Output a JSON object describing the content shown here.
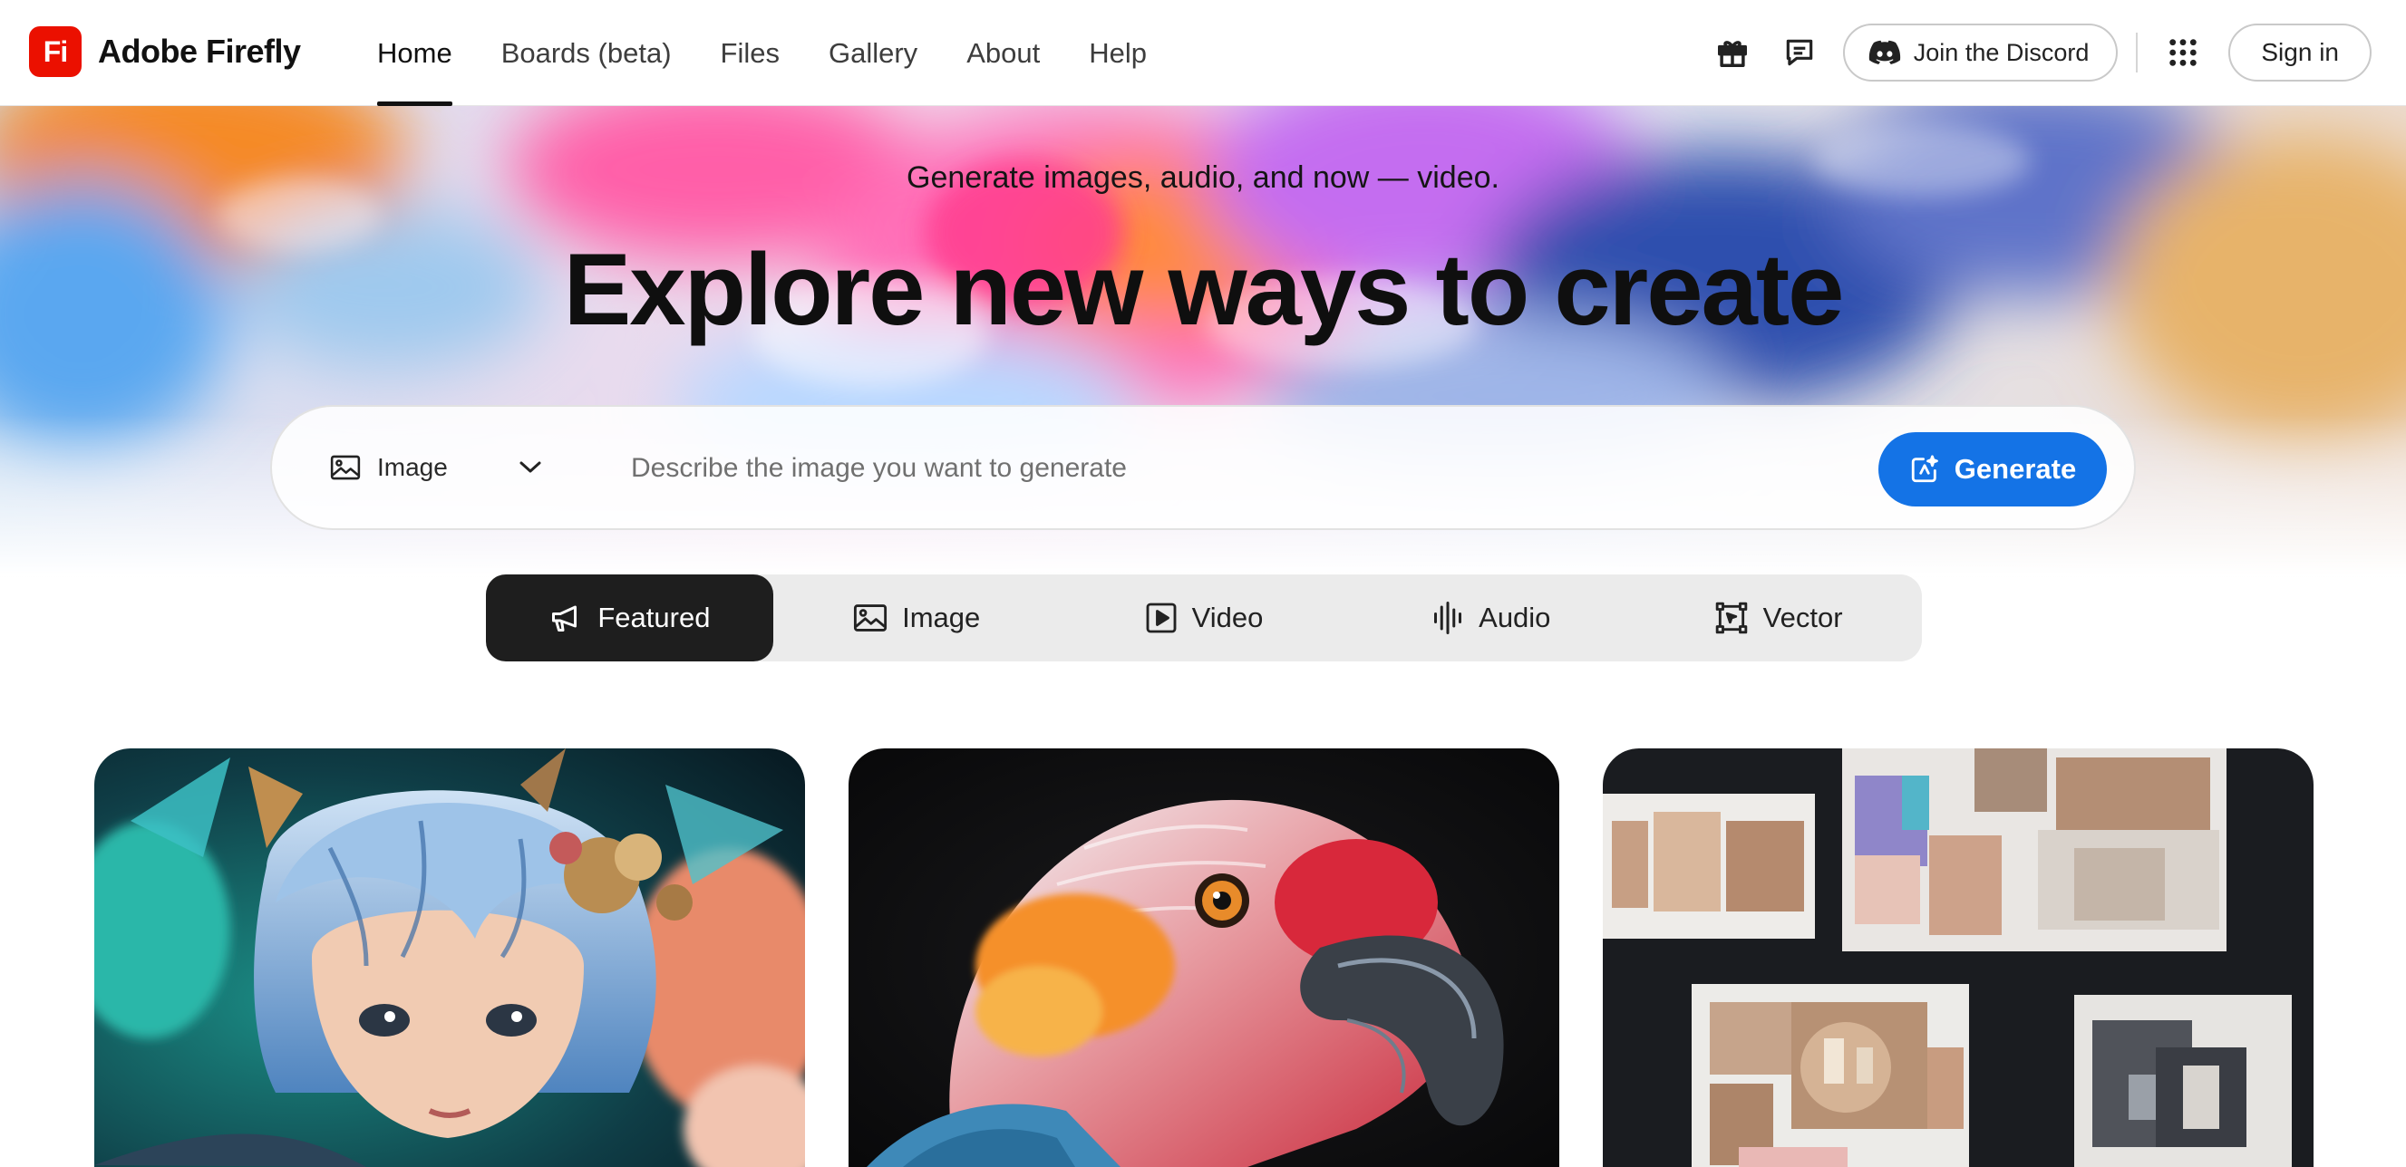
{
  "brand": {
    "logo_text": "Fi",
    "name": "Adobe Firefly",
    "color": "#eb1000"
  },
  "nav": {
    "items": [
      {
        "label": "Home",
        "active": true
      },
      {
        "label": "Boards (beta)",
        "active": false
      },
      {
        "label": "Files",
        "active": false
      },
      {
        "label": "Gallery",
        "active": false
      },
      {
        "label": "About",
        "active": false
      },
      {
        "label": "Help",
        "active": false
      }
    ]
  },
  "header_actions": {
    "gift_icon": "gift-icon",
    "feedback_icon": "chat-bubble-icon",
    "discord_label": "Join the Discord",
    "apps_icon": "apps-grid-icon",
    "signin_label": "Sign in"
  },
  "hero": {
    "subtitle": "Generate images, audio, and now — video.",
    "title": "Explore new ways to create"
  },
  "prompt": {
    "media_type": "Image",
    "placeholder": "Describe the image you want to generate",
    "value": "",
    "generate_label": "Generate",
    "accent": "#1473e6"
  },
  "category_tabs": [
    {
      "label": "Featured",
      "icon": "megaphone-icon",
      "active": true
    },
    {
      "label": "Image",
      "icon": "image-icon",
      "active": false
    },
    {
      "label": "Video",
      "icon": "play-icon",
      "active": false
    },
    {
      "label": "Audio",
      "icon": "waveform-icon",
      "active": false
    },
    {
      "label": "Vector",
      "icon": "vector-icon",
      "active": false
    }
  ],
  "gallery": [
    {
      "subject": "blue-haired-child-portrait"
    },
    {
      "subject": "parrot-closeup"
    },
    {
      "subject": "product-moodboard"
    }
  ]
}
